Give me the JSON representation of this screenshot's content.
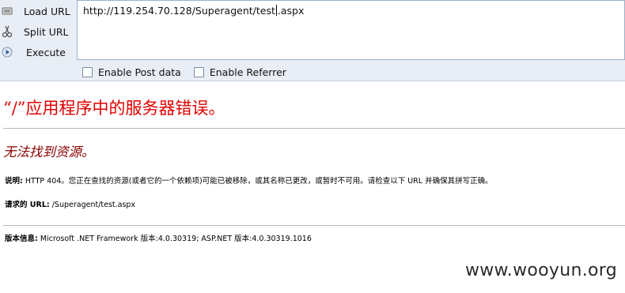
{
  "toolbar": {
    "actions": [
      {
        "label": "Load URL",
        "icon": "load-url-icon"
      },
      {
        "label": "Split URL",
        "icon": "split-url-icon"
      },
      {
        "label": "Execute",
        "icon": "execute-icon"
      }
    ],
    "url_before_caret": "http://119.254.70.128/Superagent/test",
    "url_after_caret": ".aspx",
    "options": [
      {
        "label": "Enable Post data",
        "checked": false
      },
      {
        "label": "Enable Referrer",
        "checked": false
      }
    ]
  },
  "error_page": {
    "title": "“/”应用程序中的服务器错误。",
    "subtitle": "无法找到资源。",
    "description_label": "说明:",
    "description_text": " HTTP 404。您正在查找的资源(或者它的一个依赖项)可能已被移除，或其名称已更改，或暂时不可用。请检查以下 URL 并确保其拼写正确。",
    "requested_url_label": "请求的 URL:",
    "requested_url_value": " /Superagent/test.aspx",
    "version_label": "版本信息:",
    "version_text": " Microsoft .NET Framework 版本:4.0.30319; ASP.NET 版本:4.0.30319.1016"
  },
  "watermark": "www.wooyun.org",
  "colors": {
    "title_red": "#e00000",
    "subtitle_darkred": "#8b0000",
    "toolbar_bg": "#e9eef6"
  }
}
